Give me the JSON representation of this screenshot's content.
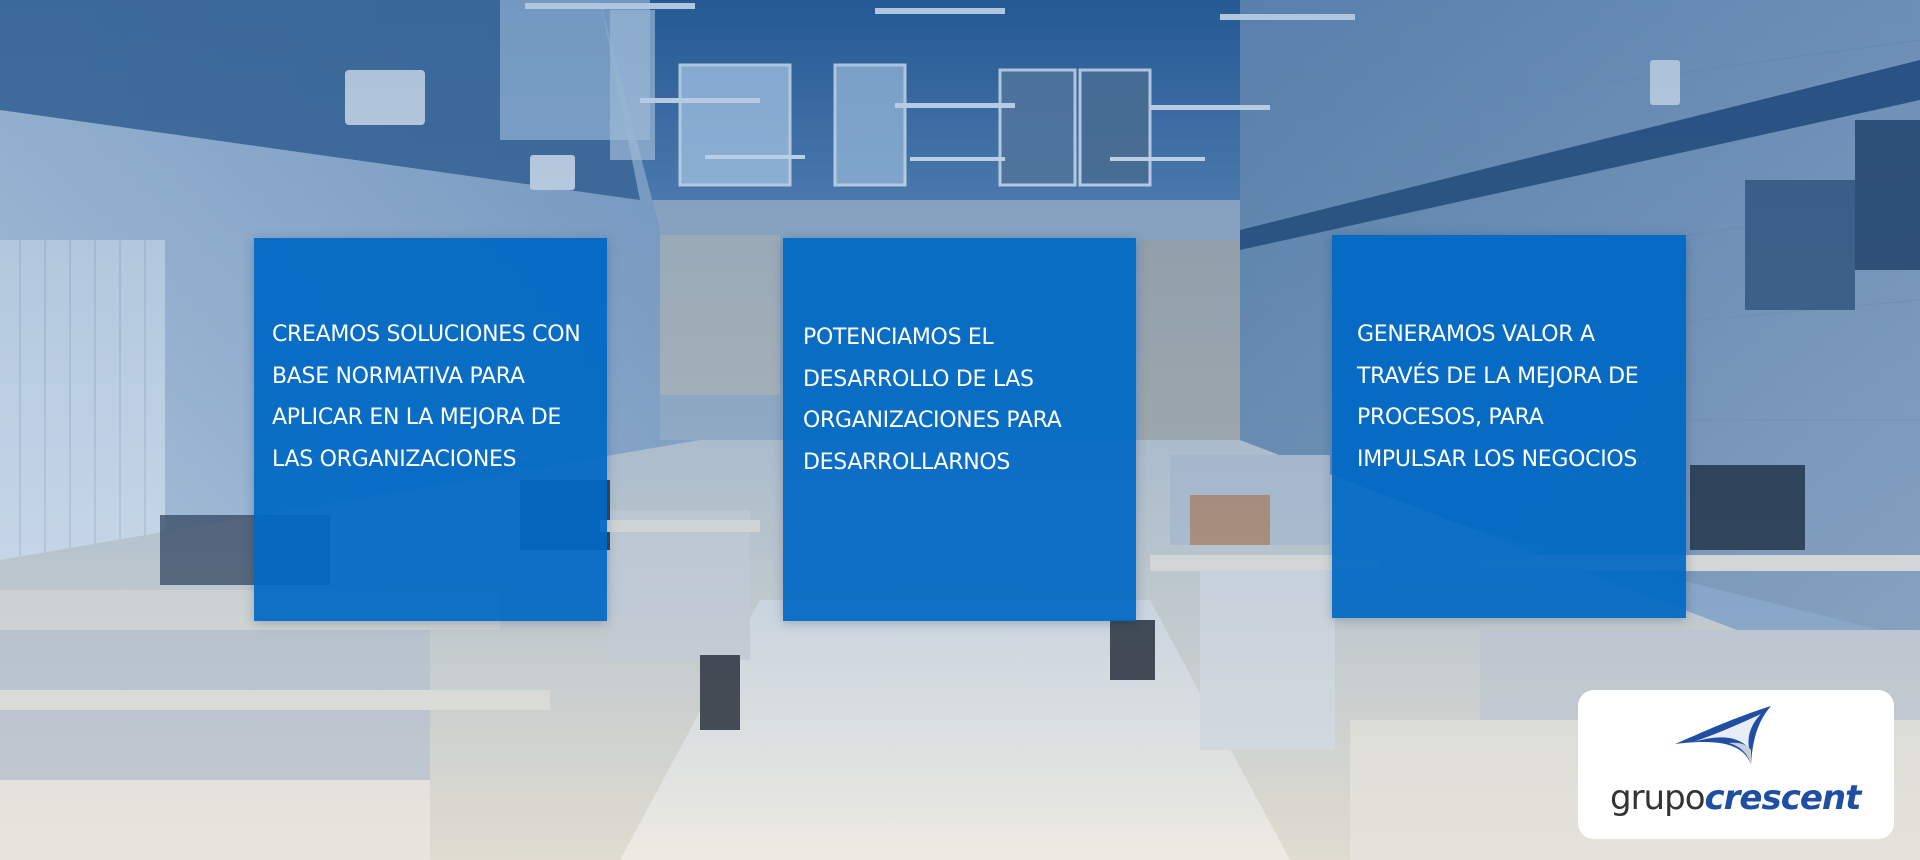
{
  "cards": [
    {
      "text": "CREAMOS SOLUCIONES CON\nBASE NORMATIVA PARA\nAPLICAR EN LA MEJORA DE\nLAS ORGANIZACIONES"
    },
    {
      "text": "POTENCIAMOS EL\nDESARROLLO DE LAS\nORGANIZACIONES PARA\nDESARROLLARNOS"
    },
    {
      "text": "GENERAMOS VALOR A\nTRAVÉS DE LA MEJORA DE\nPROCESOS, PARA\nIMPULSAR LOS NEGOCIOS"
    }
  ],
  "logo": {
    "word_regular": "grupo",
    "word_bold": "crescent"
  },
  "colors": {
    "card_blue": "#0068C4",
    "logo_blue": "#1F4EA3",
    "logo_gray": "#333333"
  }
}
